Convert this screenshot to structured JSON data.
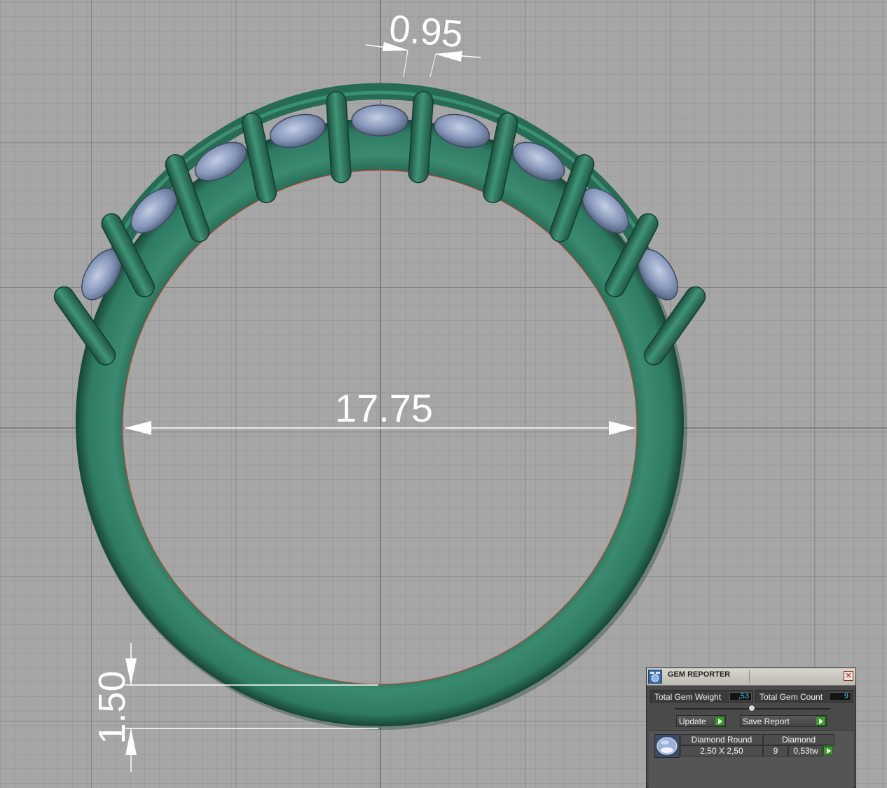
{
  "dimensions": {
    "top_gap": "0.95",
    "inner_diameter": "17.75",
    "band_thickness": "1.50"
  },
  "colors": {
    "background": "#a6a6a6",
    "grid": "#8e8e8e",
    "metal": "#2f7a63",
    "metal_dark": "#1e4f40",
    "gem": "#8fa0c0",
    "dimension_line": "#ffffff"
  },
  "gem_reporter": {
    "title": "GEM REPORTER",
    "close_icon": "close-icon",
    "total_gem_weight_label": "Total Gem Weight",
    "total_gem_weight_value": ",53",
    "total_gem_count_label": "Total Gem Count",
    "total_gem_count_value": "9",
    "update_label": "Update",
    "save_report_label": "Save Report",
    "gems": [
      {
        "shape": "Diamond Round",
        "material": "Diamond",
        "size": "2,50 X 2,50",
        "count": "9",
        "weight": "0,53tw",
        "icon": "round-gem-icon"
      }
    ]
  }
}
